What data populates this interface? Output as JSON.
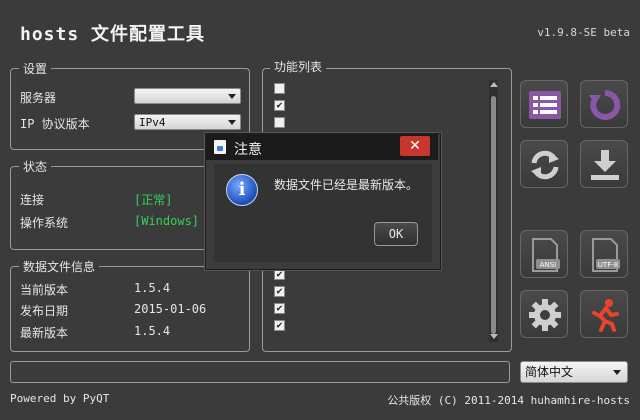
{
  "header": {
    "title": "hosts 文件配置工具",
    "version": "v1.9.8-SE beta"
  },
  "settings": {
    "title": "设置",
    "server_label": "服务器",
    "server_value": "",
    "ip_label": "IP 协议版本",
    "ip_value": "IPv4"
  },
  "status": {
    "title": "状态",
    "connection_label": "连接",
    "connection_value": "[正常]",
    "os_label": "操作系统",
    "os_value": "[Windows]"
  },
  "data_info": {
    "title": "数据文件信息",
    "current_label": "当前版本",
    "current_value": "1.5.4",
    "release_label": "发布日期",
    "release_value": "2015-01-06",
    "latest_label": "最新版本",
    "latest_value": "1.5.4"
  },
  "functions": {
    "title": "功能列表",
    "items": [
      {
        "label": "",
        "checked": false
      },
      {
        "label": "",
        "checked": true
      },
      {
        "label": "",
        "checked": false
      },
      {
        "label": "",
        "checked": true
      },
      {
        "label": "",
        "checked": true
      },
      {
        "label": "",
        "checked": true
      },
      {
        "label": "",
        "checked": true
      }
    ]
  },
  "toolbar": {
    "buttons": [
      {
        "name": "function-list-button",
        "icon": "list-icon",
        "color": "#8a56a6"
      },
      {
        "name": "reset-button",
        "icon": "refresh-icon",
        "color": "#8a56a6"
      },
      {
        "name": "update-button",
        "icon": "sync-icon",
        "color": "#cfcfcf"
      },
      {
        "name": "download-button",
        "icon": "download-icon",
        "color": "#cfcfcf"
      },
      {
        "name": "export-ansi-button",
        "icon": "ansi-file-icon",
        "label": "ANSI",
        "color": "#9a9a9a"
      },
      {
        "name": "export-utf8-button",
        "icon": "utf8-file-icon",
        "label": "UTF-8",
        "color": "#9a9a9a"
      },
      {
        "name": "settings-button",
        "icon": "gear-icon",
        "color": "#cfcfcf"
      },
      {
        "name": "exit-button",
        "icon": "running-man-icon",
        "color": "#e9442e"
      }
    ]
  },
  "language": {
    "value": "简体中文"
  },
  "footer": {
    "left": "Powered by PyQT",
    "right": "公共版权 (C) 2011-2014 huhamhire-hosts"
  },
  "dialog": {
    "title": "注意",
    "close": "✕",
    "message": "数据文件已经是最新版本。",
    "ok": "OK"
  }
}
